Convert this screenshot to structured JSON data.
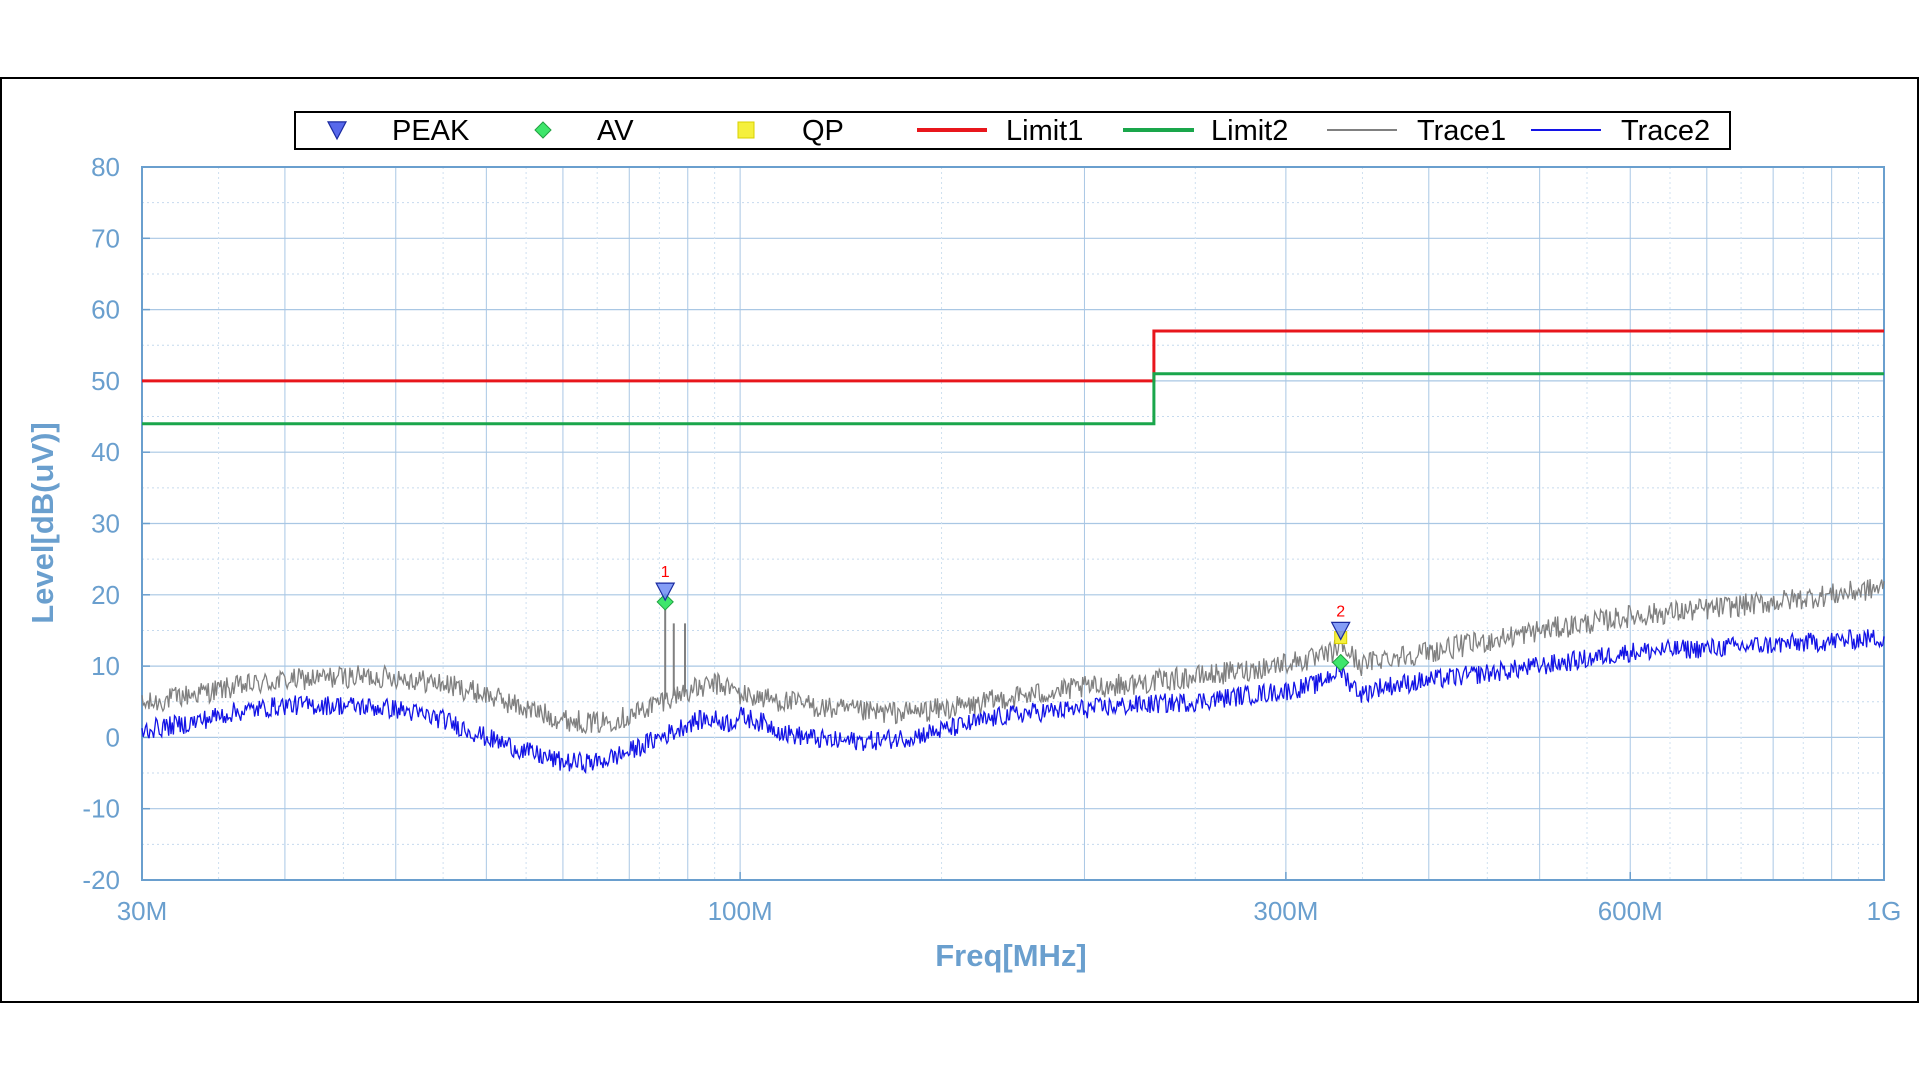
{
  "chart_data": {
    "type": "line",
    "title": "",
    "xlabel": "Freq[MHz]",
    "ylabel": "Level[dB(uV)]",
    "x_scale": "log",
    "xlim": [
      30,
      1000
    ],
    "ylim": [
      -20,
      80
    ],
    "grid": true,
    "legend_position": "top",
    "x_ticks": [
      {
        "value": 30,
        "label": "30M"
      },
      {
        "value": 100,
        "label": "100M"
      },
      {
        "value": 300,
        "label": "300M"
      },
      {
        "value": 600,
        "label": "600M"
      },
      {
        "value": 1000,
        "label": "1G"
      }
    ],
    "y_ticks": [
      {
        "value": 80,
        "label": "80"
      },
      {
        "value": 70,
        "label": "70"
      },
      {
        "value": 60,
        "label": "60"
      },
      {
        "value": 50,
        "label": "50"
      },
      {
        "value": 40,
        "label": "40"
      },
      {
        "value": 30,
        "label": "30"
      },
      {
        "value": 20,
        "label": "20"
      },
      {
        "value": 10,
        "label": "10"
      },
      {
        "value": 0,
        "label": "0"
      },
      {
        "value": -10,
        "label": "-10"
      },
      {
        "value": -20,
        "label": "-20"
      }
    ],
    "legend": [
      {
        "name": "PEAK",
        "kind": "marker-triangle",
        "color": "#3a4de8"
      },
      {
        "name": "AV",
        "kind": "marker-diamond",
        "color": "#3ee66b"
      },
      {
        "name": "QP",
        "kind": "marker-square",
        "color": "#f5f03c"
      },
      {
        "name": "Limit1",
        "kind": "line",
        "color": "#e8161c"
      },
      {
        "name": "Limit2",
        "kind": "line",
        "color": "#1aa64b"
      },
      {
        "name": "Trace1",
        "kind": "line-thin",
        "color": "#808080"
      },
      {
        "name": "Trace2",
        "kind": "line-thin",
        "color": "#1414e6"
      }
    ],
    "limits": [
      {
        "name": "Limit1",
        "color": "#e8161c",
        "points": [
          [
            30,
            50
          ],
          [
            230,
            50
          ],
          [
            230,
            57
          ],
          [
            1000,
            57
          ]
        ]
      },
      {
        "name": "Limit2",
        "color": "#1aa64b",
        "points": [
          [
            30,
            44
          ],
          [
            230,
            44
          ],
          [
            230,
            51
          ],
          [
            1000,
            51
          ]
        ]
      }
    ],
    "series": [
      {
        "name": "Trace1",
        "color": "#808080",
        "noise": 1.6,
        "x": [
          30,
          33,
          36,
          40,
          45,
          50,
          55,
          60,
          65,
          70,
          75,
          80,
          85,
          88,
          90,
          93,
          95,
          98,
          100,
          105,
          110,
          120,
          130,
          140,
          150,
          160,
          170,
          180,
          200,
          220,
          250,
          280,
          300,
          320,
          330,
          335,
          340,
          350,
          360,
          400,
          450,
          500,
          550,
          600,
          700,
          800,
          900,
          1000
        ],
        "y": [
          4.5,
          6,
          7,
          8,
          8.5,
          8.5,
          7.5,
          6,
          4,
          2.5,
          2,
          3,
          5,
          6,
          6.5,
          7,
          7.5,
          7,
          6,
          5.5,
          5,
          4,
          3.5,
          3.5,
          4,
          4.5,
          5.5,
          6,
          7,
          7.5,
          8.5,
          9.5,
          10.5,
          11,
          12,
          13,
          12,
          10,
          11,
          12,
          13.5,
          15,
          16,
          17,
          18,
          19,
          20,
          21
        ]
      },
      {
        "name": "Trace2",
        "color": "#1414e6",
        "noise": 1.4,
        "x": [
          30,
          33,
          36,
          40,
          45,
          50,
          55,
          60,
          65,
          70,
          75,
          80,
          85,
          88,
          90,
          93,
          95,
          98,
          100,
          105,
          110,
          120,
          130,
          140,
          150,
          160,
          170,
          180,
          200,
          220,
          250,
          280,
          300,
          320,
          330,
          335,
          340,
          350,
          360,
          400,
          450,
          500,
          550,
          600,
          700,
          800,
          900,
          1000
        ],
        "y": [
          1,
          2,
          3.5,
          4.5,
          4.5,
          4,
          2.5,
          0,
          -2,
          -3.5,
          -3.5,
          -2,
          0,
          1,
          2,
          2.5,
          2.5,
          2,
          3,
          2,
          0.5,
          -0.5,
          -0.5,
          0,
          1,
          2,
          3,
          3.5,
          4,
          4.5,
          5,
          6,
          6.5,
          7.5,
          9,
          9.5,
          8,
          6,
          7,
          8,
          9,
          10,
          11,
          12,
          12.5,
          13,
          13.5,
          14
        ]
      }
    ],
    "spikes": [
      {
        "x": 86,
        "y": 20
      },
      {
        "x": 87.5,
        "y": 16
      },
      {
        "x": 89.5,
        "y": 16
      }
    ],
    "markers": [
      {
        "id": "1",
        "freq": 86,
        "peak": 20.5,
        "av": 19
      },
      {
        "id": "2",
        "freq": 335,
        "peak": 15,
        "av": 10.5,
        "qp": 14
      }
    ]
  }
}
